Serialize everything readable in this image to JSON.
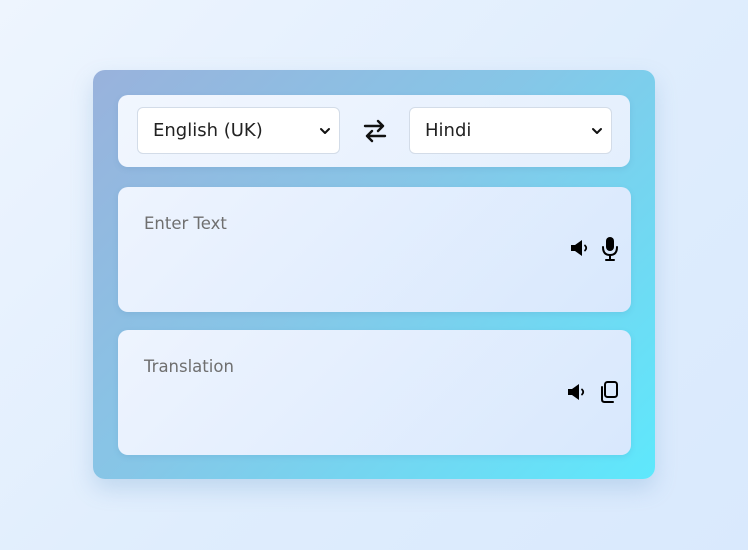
{
  "language_bar": {
    "source_language": "English (UK)",
    "target_language": "Hindi",
    "swap_icon": "swap-arrows-icon"
  },
  "input_panel": {
    "placeholder": "Enter Text",
    "value": "",
    "icons": [
      "speaker-icon",
      "microphone-icon"
    ]
  },
  "output_panel": {
    "placeholder": "Translation",
    "value": "",
    "icons": [
      "speaker-icon",
      "copy-icon"
    ]
  },
  "colors": {
    "card_gradient_start": "#99b2dc",
    "card_gradient_end": "#5ee8fc",
    "page_background": "#e6f0fd",
    "icon_color": "#000000"
  }
}
